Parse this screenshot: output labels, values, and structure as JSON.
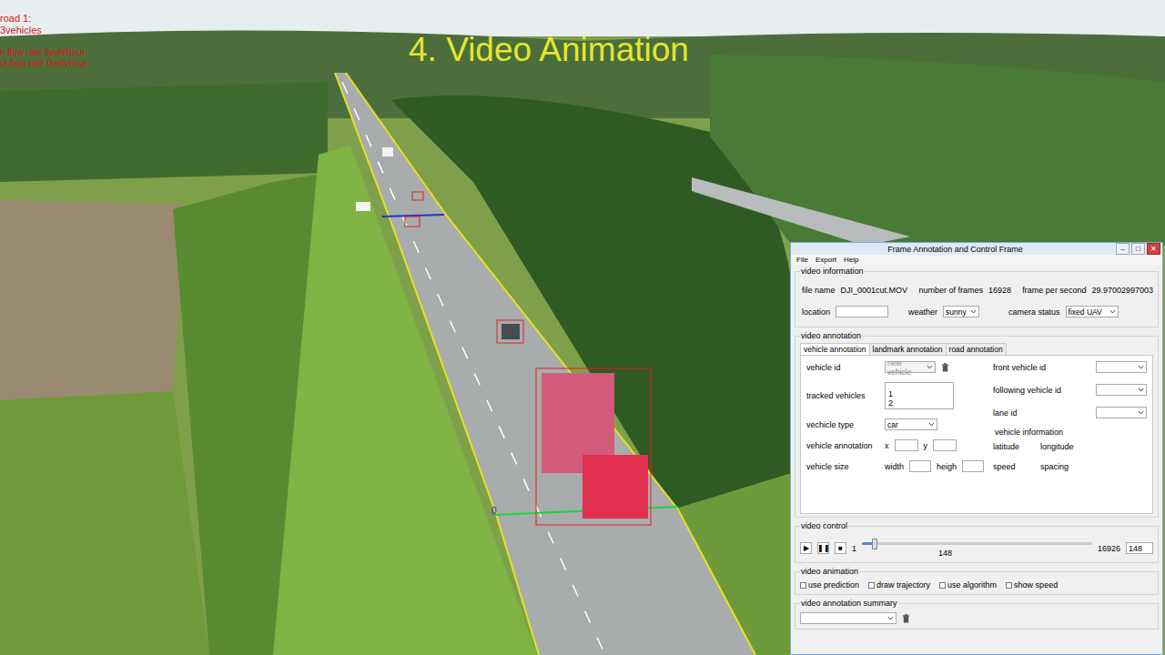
{
  "overlay": {
    "title": "4. Video Animation",
    "lines": [
      "road 1:",
      "3vehicles",
      "n flow rate 3veh/hour",
      "ut flow rate 0veh/hour"
    ],
    "line_label": "0"
  },
  "window": {
    "title": "Frame Annotation and Control Frame",
    "buttons": [
      "–",
      "□",
      "✕"
    ]
  },
  "menu": [
    "File",
    "Export",
    "Help"
  ],
  "info": {
    "legend": "video information",
    "file_name_label": "file name",
    "file_name": "DJI_0001cut.MOV",
    "frames_label": "number of frames",
    "frames": "16928",
    "fps_label": "frame per second",
    "fps": "29.97002997003",
    "location_label": "location",
    "location": "",
    "weather_label": "weather",
    "weather": "sunny",
    "camera_label": "camera status",
    "camera": "fixed UAV"
  },
  "annotation": {
    "legend": "video annotation",
    "tabs": [
      {
        "label": "vehicle annotation",
        "selected": true
      },
      {
        "label": "landmark annotation",
        "selected": false
      },
      {
        "label": "road annotation",
        "selected": false
      }
    ],
    "vehicle_id_label": "vehicle id",
    "vehicle_id": {
      "value": "new vehicle",
      "disabled": true
    },
    "tracked_label": "tracked vehicles",
    "tracked": [
      "1",
      "2"
    ],
    "type_label": "vechicle type",
    "type": "car",
    "annot_label": "vehicle annotation",
    "x_label": "x",
    "x": "",
    "y_label": "y",
    "y": "",
    "size_label": "vehicle size",
    "width_label": "width",
    "width": "",
    "height_label": "heigh",
    "height": "",
    "front_label": "front vehicle id",
    "front": "",
    "following_label": "following vehicle id",
    "following": "",
    "lane_label": "lane id",
    "lane": "",
    "info_title": "vehicle information",
    "info_fields": [
      "latitude",
      "longitude",
      "speed",
      "spacing"
    ]
  },
  "control": {
    "legend": "video control",
    "buttons": [
      "▶",
      "❚❚",
      "■"
    ],
    "start": "1",
    "end": "16926",
    "current": "148",
    "frame_input": "148",
    "level": 0.05
  },
  "animation": {
    "legend": "video animation",
    "options": [
      {
        "label": "use prediction",
        "checked": false
      },
      {
        "label": "draw trajectory",
        "checked": false
      },
      {
        "label": "use algorithm",
        "checked": false
      },
      {
        "label": "show speed",
        "checked": false
      }
    ]
  },
  "summary": {
    "legend": "video annotation summary",
    "value": ""
  }
}
